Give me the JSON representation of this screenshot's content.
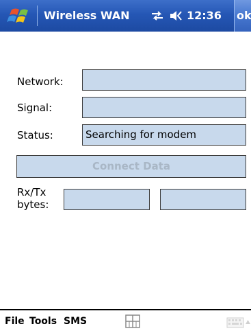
{
  "titlebar": {
    "title": "Wireless WAN",
    "clock": "12:36",
    "ok_label": "ok",
    "start_icon": "windows-flag-icon",
    "connectivity_icon": "connectivity-arrows-icon",
    "volume_icon": "speaker-icon",
    "accent": "#2557b5"
  },
  "form": {
    "network_label": "Network:",
    "network_value": "",
    "signal_label": "Signal:",
    "signal_value": "",
    "status_label": "Status:",
    "status_value": "Searching for modem",
    "connect_button_label": "Connect Data",
    "rxtx_label_line1": "Rx/Tx",
    "rxtx_label_line2": "bytes:",
    "rx_value": "",
    "tx_value": "",
    "field_color": "#c8d9ec"
  },
  "menubar": {
    "file_label": "File",
    "tools_label": "Tools",
    "sms_label": "SMS",
    "input_panel_icon": "keyboard-icon"
  }
}
